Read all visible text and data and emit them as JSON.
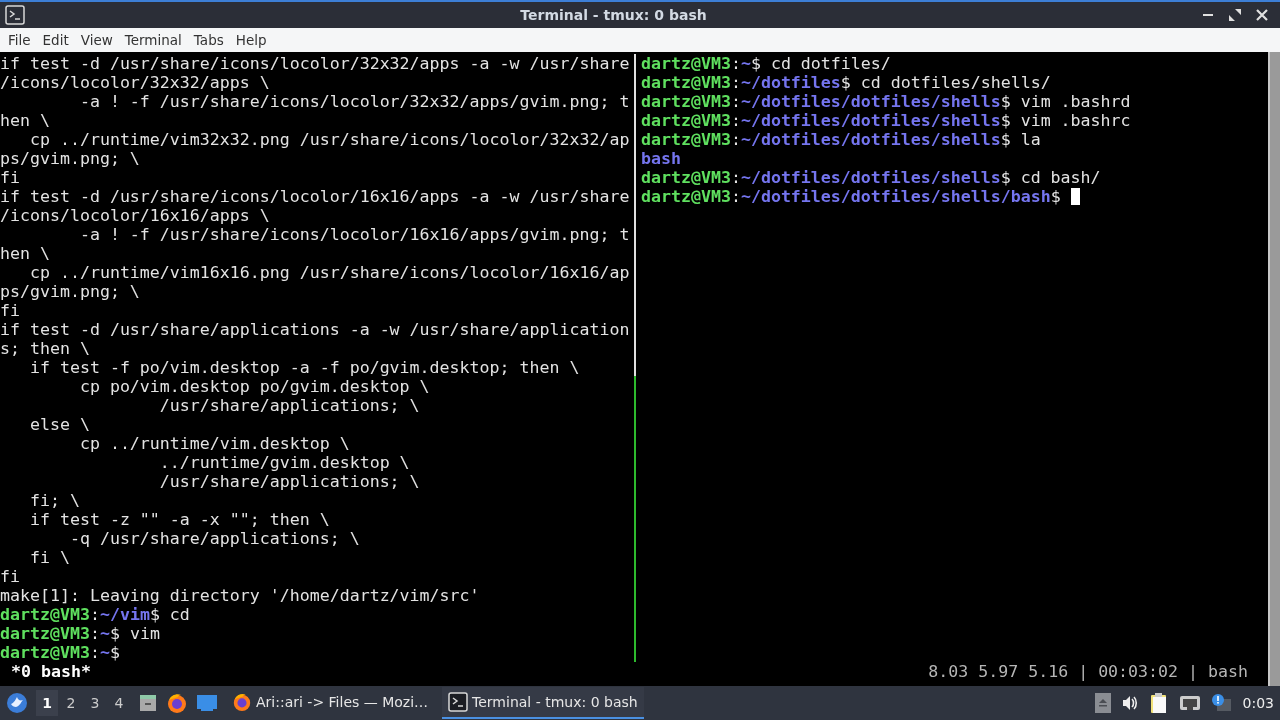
{
  "window": {
    "title": "Terminal - tmux: 0 bash"
  },
  "menu": [
    "File",
    "Edit",
    "View",
    "Terminal",
    "Tabs",
    "Help"
  ],
  "panes": [
    {
      "cursor": false,
      "lines": [
        [
          {
            "kind": "text",
            "text": "if test -d /usr/share/icons/locolor/32x32/apps -a -w /usr/share"
          }
        ],
        [
          {
            "kind": "text",
            "text": "/icons/locolor/32x32/apps \\"
          }
        ],
        [
          {
            "kind": "text",
            "text": "        -a ! -f /usr/share/icons/locolor/32x32/apps/gvim.png; t"
          }
        ],
        [
          {
            "kind": "text",
            "text": "hen \\"
          }
        ],
        [
          {
            "kind": "text",
            "text": "   cp ../runtime/vim32x32.png /usr/share/icons/locolor/32x32/ap"
          }
        ],
        [
          {
            "kind": "text",
            "text": "ps/gvim.png; \\"
          }
        ],
        [
          {
            "kind": "text",
            "text": "fi"
          }
        ],
        [
          {
            "kind": "text",
            "text": "if test -d /usr/share/icons/locolor/16x16/apps -a -w /usr/share"
          }
        ],
        [
          {
            "kind": "text",
            "text": "/icons/locolor/16x16/apps \\"
          }
        ],
        [
          {
            "kind": "text",
            "text": "        -a ! -f /usr/share/icons/locolor/16x16/apps/gvim.png; t"
          }
        ],
        [
          {
            "kind": "text",
            "text": "hen \\"
          }
        ],
        [
          {
            "kind": "text",
            "text": "   cp ../runtime/vim16x16.png /usr/share/icons/locolor/16x16/ap"
          }
        ],
        [
          {
            "kind": "text",
            "text": "ps/gvim.png; \\"
          }
        ],
        [
          {
            "kind": "text",
            "text": "fi"
          }
        ],
        [
          {
            "kind": "text",
            "text": "if test -d /usr/share/applications -a -w /usr/share/application"
          }
        ],
        [
          {
            "kind": "text",
            "text": "s; then \\"
          }
        ],
        [
          {
            "kind": "text",
            "text": "   if test -f po/vim.desktop -a -f po/gvim.desktop; then \\"
          }
        ],
        [
          {
            "kind": "text",
            "text": "        cp po/vim.desktop po/gvim.desktop \\"
          }
        ],
        [
          {
            "kind": "text",
            "text": "                /usr/share/applications; \\"
          }
        ],
        [
          {
            "kind": "text",
            "text": "   else \\"
          }
        ],
        [
          {
            "kind": "text",
            "text": "        cp ../runtime/vim.desktop \\"
          }
        ],
        [
          {
            "kind": "text",
            "text": "                ../runtime/gvim.desktop \\"
          }
        ],
        [
          {
            "kind": "text",
            "text": "                /usr/share/applications; \\"
          }
        ],
        [
          {
            "kind": "text",
            "text": "   fi; \\"
          }
        ],
        [
          {
            "kind": "text",
            "text": "   if test -z \"\" -a -x \"\"; then \\"
          }
        ],
        [
          {
            "kind": "text",
            "text": "       -q /usr/share/applications; \\"
          }
        ],
        [
          {
            "kind": "text",
            "text": "   fi \\"
          }
        ],
        [
          {
            "kind": "text",
            "text": "fi"
          }
        ],
        [
          {
            "kind": "text",
            "text": "make[1]: Leaving directory '/home/dartz/vim/src'"
          }
        ],
        [
          {
            "kind": "user",
            "text": "dartz@VM3"
          },
          {
            "kind": "text",
            "text": ":"
          },
          {
            "kind": "path",
            "text": "~/vim"
          },
          {
            "kind": "text",
            "text": "$ cd"
          }
        ],
        [
          {
            "kind": "user",
            "text": "dartz@VM3"
          },
          {
            "kind": "text",
            "text": ":"
          },
          {
            "kind": "path",
            "text": "~"
          },
          {
            "kind": "text",
            "text": "$ vim"
          }
        ],
        [
          {
            "kind": "user",
            "text": "dartz@VM3"
          },
          {
            "kind": "text",
            "text": ":"
          },
          {
            "kind": "path",
            "text": "~"
          },
          {
            "kind": "text",
            "text": "$"
          }
        ]
      ]
    },
    {
      "cursor": true,
      "lines": [
        [
          {
            "kind": "user",
            "text": "dartz@VM3"
          },
          {
            "kind": "text",
            "text": ":"
          },
          {
            "kind": "path",
            "text": "~"
          },
          {
            "kind": "text",
            "text": "$ cd dotfiles/"
          }
        ],
        [
          {
            "kind": "user",
            "text": "dartz@VM3"
          },
          {
            "kind": "text",
            "text": ":"
          },
          {
            "kind": "path",
            "text": "~/dotfiles"
          },
          {
            "kind": "text",
            "text": "$ cd dotfiles/shells/"
          }
        ],
        [
          {
            "kind": "user",
            "text": "dartz@VM3"
          },
          {
            "kind": "text",
            "text": ":"
          },
          {
            "kind": "path",
            "text": "~/dotfiles/dotfiles/shells"
          },
          {
            "kind": "text",
            "text": "$ vim .bashrd"
          }
        ],
        [
          {
            "kind": "user",
            "text": "dartz@VM3"
          },
          {
            "kind": "text",
            "text": ":"
          },
          {
            "kind": "path",
            "text": "~/dotfiles/dotfiles/shells"
          },
          {
            "kind": "text",
            "text": "$ vim .bashrc"
          }
        ],
        [
          {
            "kind": "user",
            "text": "dartz@VM3"
          },
          {
            "kind": "text",
            "text": ":"
          },
          {
            "kind": "path",
            "text": "~/dotfiles/dotfiles/shells"
          },
          {
            "kind": "text",
            "text": "$ la"
          }
        ],
        [
          {
            "kind": "path",
            "text": "bash"
          }
        ],
        [
          {
            "kind": "user",
            "text": "dartz@VM3"
          },
          {
            "kind": "text",
            "text": ":"
          },
          {
            "kind": "path",
            "text": "~/dotfiles/dotfiles/shells"
          },
          {
            "kind": "text",
            "text": "$ cd bash/"
          }
        ],
        [
          {
            "kind": "user",
            "text": "dartz@VM3"
          },
          {
            "kind": "text",
            "text": ":"
          },
          {
            "kind": "path",
            "text": "~/dotfiles/dotfiles/shells/bash"
          },
          {
            "kind": "text",
            "text": "$"
          }
        ]
      ]
    }
  ],
  "tmux_status": {
    "windows": "*0 bash*",
    "right": "8.03 5.97 5.16 | 00:03:02 | bash"
  },
  "taskbar": {
    "workspaces": [
      {
        "label": "1",
        "selected": true
      },
      {
        "label": "2",
        "selected": false
      },
      {
        "label": "3",
        "selected": false
      },
      {
        "label": "4",
        "selected": false
      }
    ],
    "tasks": [
      {
        "kind": "browser",
        "label": "Ari::ari -> Files — Mozi…",
        "selected": false
      },
      {
        "kind": "terminal",
        "label": "Terminal - tmux: 0 bash",
        "selected": true
      }
    ],
    "clock": "0:03"
  }
}
